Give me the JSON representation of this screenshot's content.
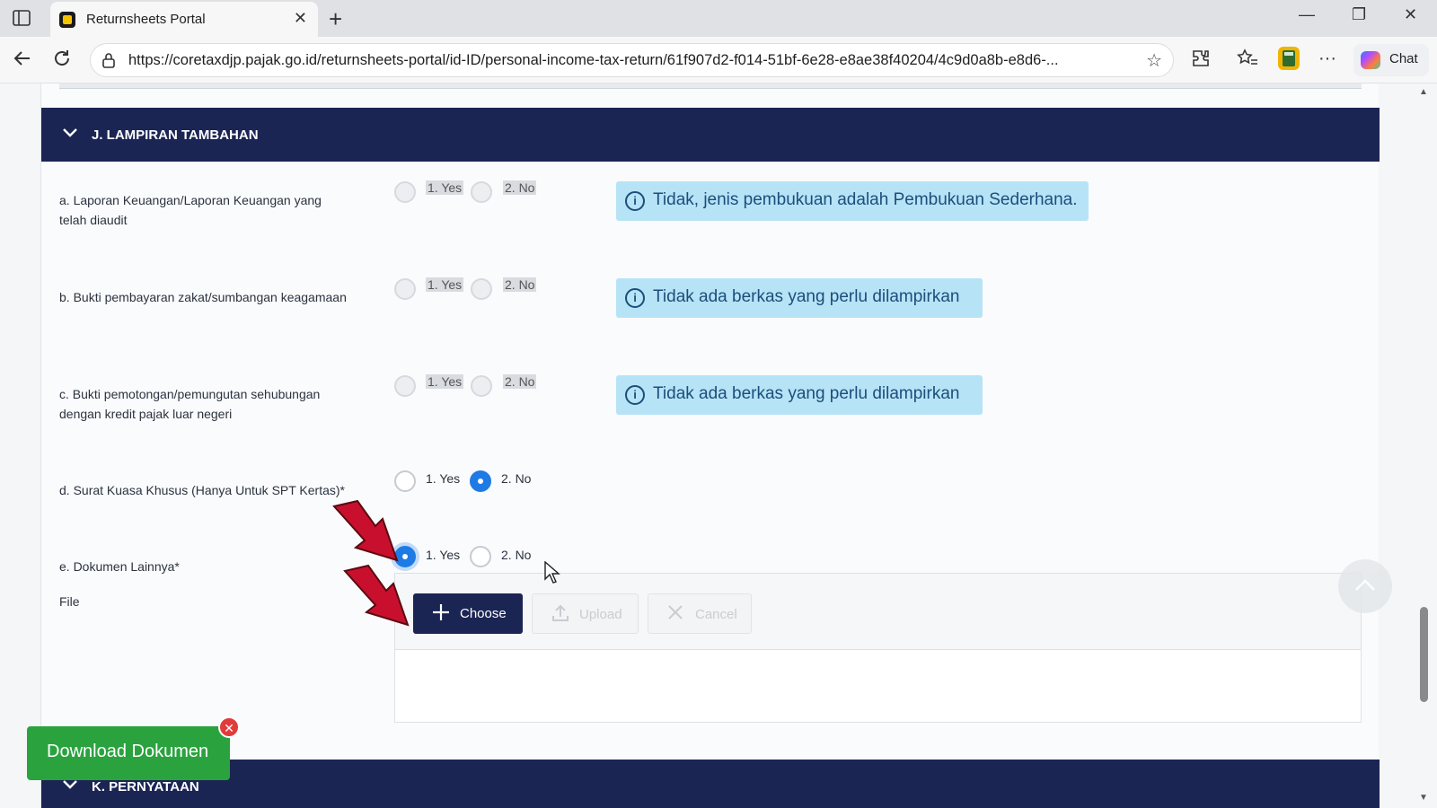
{
  "browser": {
    "tab_title": "Returnsheets Portal",
    "url": "https://coretaxdjp.pajak.go.id/returnsheets-portal/id-ID/personal-income-tax-return/61f907d2-f014-51bf-6e28-e8ae38f40204/4c9d0a8b-e8d6-...",
    "chat_label": "Chat"
  },
  "section_j": {
    "title": "J. LAMPIRAN TAMBAHAN",
    "rows": [
      {
        "label": "a. Laporan Keuangan/Laporan Keuangan yang telah diaudit",
        "yes": "1. Yes",
        "no": "2. No",
        "info": "Tidak, jenis pembukuan adalah Pembukuan Sederhana."
      },
      {
        "label": "b. Bukti pembayaran zakat/sumbangan keagamaan",
        "yes": "1. Yes",
        "no": "2. No",
        "info": "Tidak ada berkas yang perlu dilampirkan"
      },
      {
        "label": "c. Bukti pemotongan/pemungutan sehubungan dengan kredit pajak luar negeri",
        "yes": "1. Yes",
        "no": "2. No",
        "info": "Tidak ada berkas yang perlu dilampirkan"
      },
      {
        "label": "d. Surat Kuasa Khusus (Hanya Untuk SPT Kertas)*",
        "yes": "1. Yes",
        "no": "2. No",
        "selected": "2. No"
      },
      {
        "label": "e. Dokumen Lainnya*",
        "yes": "1. Yes",
        "no": "2. No",
        "selected": "1. Yes"
      }
    ],
    "file_label": "File",
    "buttons": {
      "choose": "Choose",
      "upload": "Upload",
      "cancel": "Cancel"
    }
  },
  "section_k": {
    "title": "K. PERNYATAAN"
  },
  "download": {
    "label": "Download Dokumen"
  },
  "colors": {
    "header_bg": "#1b2554",
    "info_bg": "#b7e3f7",
    "download_bg": "#2aa33f",
    "radio_selected": "#1e7be5",
    "annotation_arrow": "#c8102e"
  }
}
